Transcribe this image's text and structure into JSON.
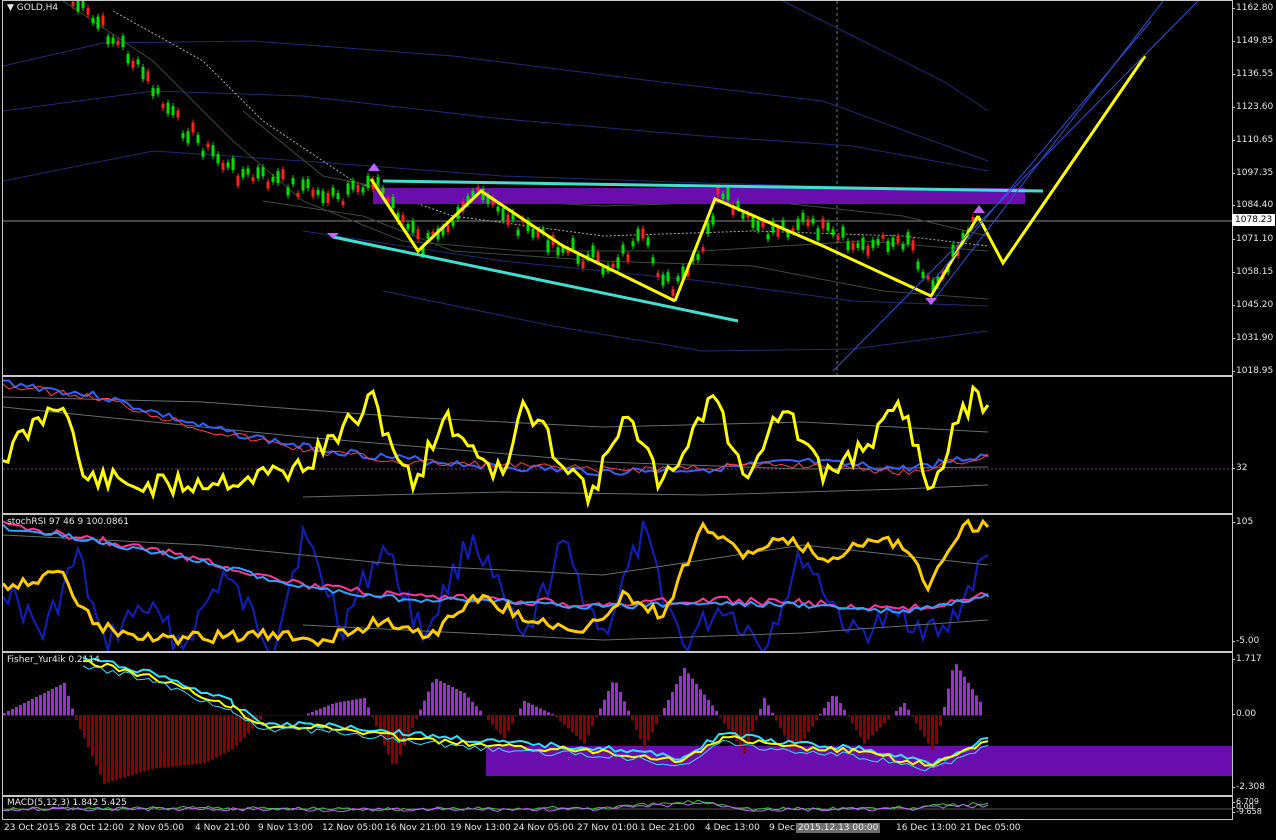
{
  "main_chart": {
    "title": "GOLD,H4",
    "current_price": "1078.23",
    "price_ticks": [
      "1162.80",
      "1149.85",
      "1136.55",
      "1123.60",
      "1110.65",
      "1097.35",
      "1084.40",
      "1071.10",
      "1058.15",
      "1045.20",
      "1031.90",
      "1018.95"
    ]
  },
  "indicator_1": {
    "ticks": [
      "32"
    ]
  },
  "indicator_2": {
    "label": "stochRSI 97 46 9 100.0861",
    "ticks": [
      "105",
      "-5.00"
    ]
  },
  "indicator_3": {
    "label": "Fisher_Yur4ik 0.2114",
    "ticks": [
      "1.717",
      "0.00",
      "-2.308"
    ]
  },
  "indicator_4": {
    "label": "MACD(5,12,3) 1.842 5.425",
    "ticks": [
      "6.709",
      "0.00",
      "-9.658"
    ]
  },
  "time_axis": {
    "labels": [
      "23 Oct 2015",
      "28 Oct 12:00",
      "2 Nov 05:00",
      "4 Nov 21:00",
      "9 Nov 13:00",
      "12 Nov 05:00",
      "16 Nov 21:00",
      "19 Nov 13:00",
      "24 Nov 05:00",
      "27 Nov 01:00",
      "1 Dec 21:00",
      "4 Dec 13:00",
      "9 Dec",
      "16 Dec 13:00",
      "21 Dec 05:00"
    ],
    "crosshair_label": "2015.12.13 00:00"
  },
  "colors": {
    "background": "#000000",
    "bull_candle": "#00e000",
    "bear_candle": "#ff2020",
    "trendline_yellow": "#ffff00",
    "trendline_cyan": "#40e0d0",
    "zone_purple": "#6a0dad",
    "fisher_hist_pos": "#9a30d0",
    "fisher_hist_neg": "#8b0000"
  }
}
